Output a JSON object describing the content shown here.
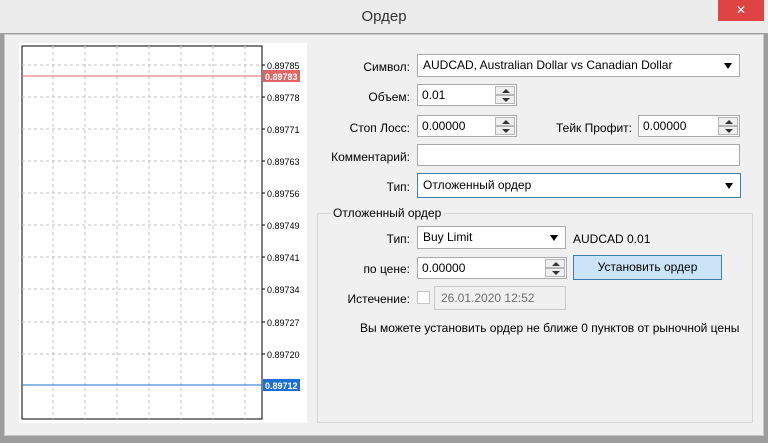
{
  "window": {
    "title": "Ордер",
    "close_glyph": "✕"
  },
  "chart": {
    "price_labels": [
      "0.89785",
      "0.89778",
      "0.89771",
      "0.89763",
      "0.89756",
      "0.89749",
      "0.89741",
      "0.89734",
      "0.89727",
      "0.89720"
    ],
    "ask_price": "0.89783",
    "bid_price": "0.89712",
    "ask_color": "#e06666",
    "bid_color": "#1c6fd6"
  },
  "form": {
    "symbol_label": "Символ:",
    "symbol_value": "AUDCAD, Australian Dollar vs Canadian Dollar",
    "volume_label": "Объем:",
    "volume_value": "0.01",
    "stoploss_label": "Стоп Лосс:",
    "stoploss_value": "0.00000",
    "takeprofit_label": "Тейк Профит:",
    "takeprofit_value": "0.00000",
    "comment_label": "Комментарий:",
    "comment_value": "",
    "type_label": "Тип:",
    "type_value": "Отложенный ордер"
  },
  "pending": {
    "group_title": "Отложенный ордер",
    "type_label": "Тип:",
    "type_value": "Buy Limit",
    "summary": "AUDCAD 0.01",
    "price_label": "по цене:",
    "price_value": "0.00000",
    "place_button": "Установить ордер",
    "expiry_label": "Истечение:",
    "expiry_value": "26.01.2020 12:52",
    "note": "Вы можете установить ордер не ближе 0 пунктов от рыночной цены"
  }
}
